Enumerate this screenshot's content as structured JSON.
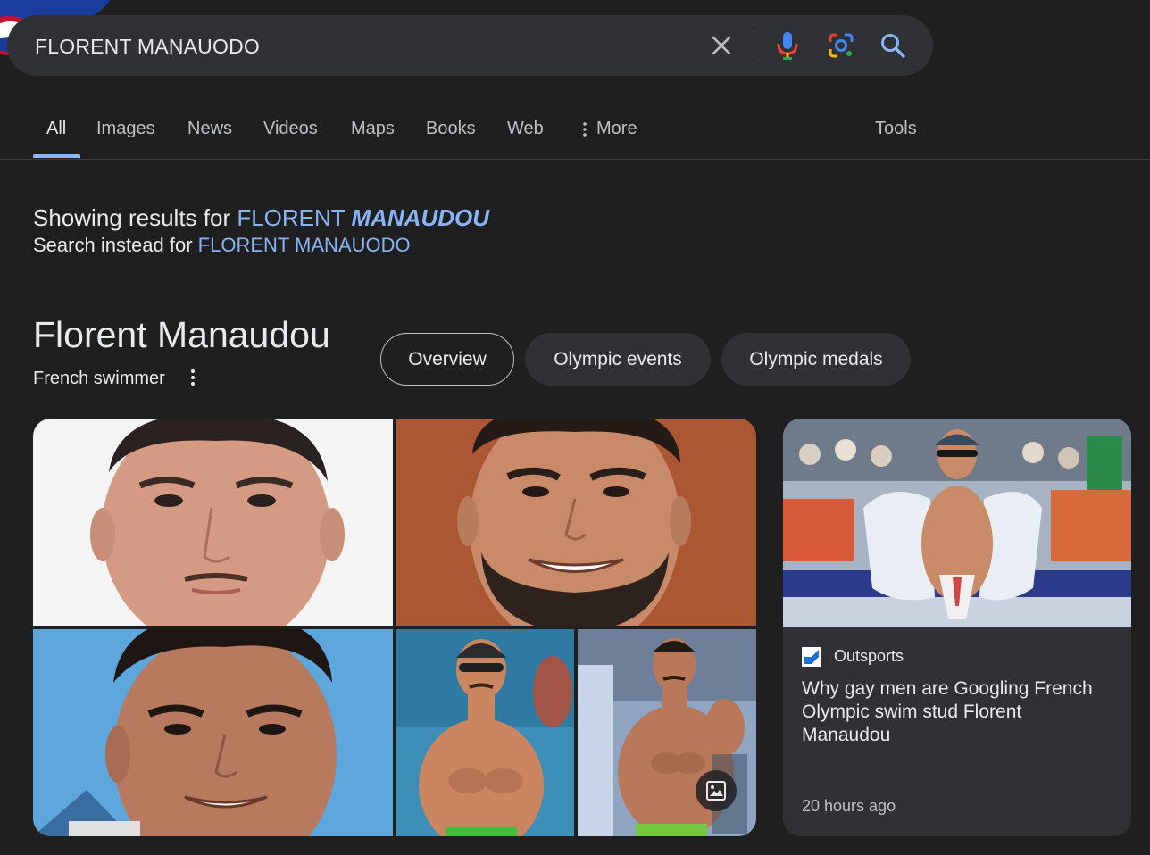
{
  "search": {
    "query": "FLORENT MANAUODO",
    "icons": [
      "close-icon",
      "microphone-icon",
      "lens-icon",
      "search-icon"
    ]
  },
  "tabs": [
    {
      "label": "All",
      "active": true
    },
    {
      "label": "Images"
    },
    {
      "label": "News"
    },
    {
      "label": "Videos"
    },
    {
      "label": "Maps"
    },
    {
      "label": "Books"
    },
    {
      "label": "Web"
    },
    {
      "label": "More",
      "icon": "more-vert-icon"
    },
    {
      "label": "Tools"
    }
  ],
  "spelling": {
    "showing_prefix": "Showing results for",
    "corrected_part1": "FLORENT",
    "corrected_part2": "MANAUDOU",
    "instead_prefix": "Search instead for",
    "original_query": "FLORENT MANAUODO"
  },
  "knowledge_panel": {
    "title": "Florent Manaudou",
    "subtitle": "French swimmer",
    "chips": [
      {
        "label": "Overview",
        "selected": true
      },
      {
        "label": "Olympic events"
      },
      {
        "label": "Olympic medals"
      }
    ]
  },
  "news": {
    "source": "Outsports",
    "title": "Why gay men are Googling French Olympic swim stud Florent Manaudou",
    "time": "20 hours ago"
  },
  "colors": {
    "background": "#1f1f1f",
    "surface": "#303134",
    "link": "#8ab4f8",
    "text": "#e8eaed",
    "muted": "#bdc1c6"
  }
}
